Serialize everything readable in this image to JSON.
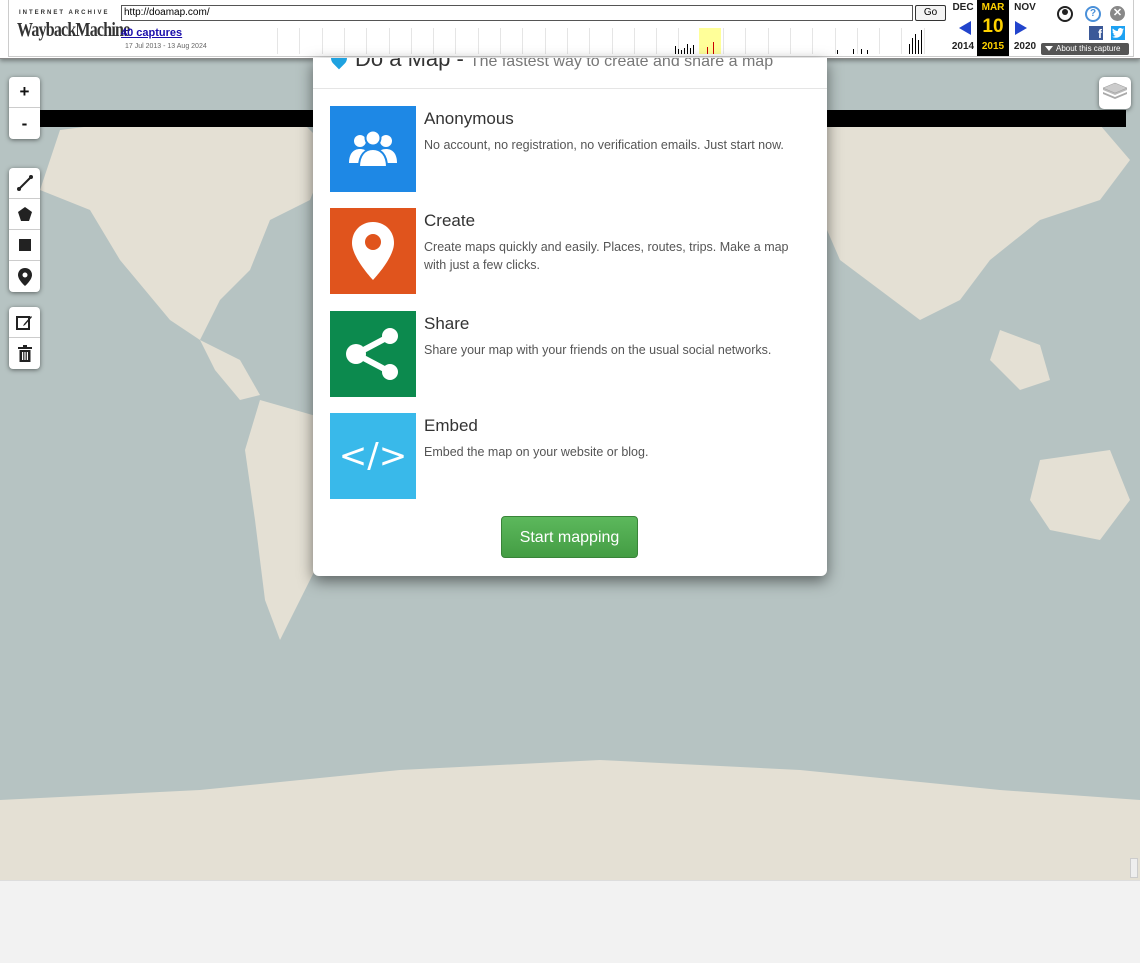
{
  "wayback": {
    "logo_top": "INTERNET ARCHIVE",
    "logo_wayback": "Wayback",
    "logo_machine": "Machine",
    "url": "http://doamap.com/",
    "go_label": "Go",
    "captures": "40 captures",
    "range": "17 Jul 2013 - 13 Aug 2024",
    "prev_month": "DEC",
    "prev_year": "2014",
    "cur_month": "MAR",
    "cur_day": "10",
    "cur_year": "2015",
    "next_month": "NOV",
    "next_year": "2020",
    "help_glyph": "?",
    "close_glyph": "✕",
    "fb_glyph": "f",
    "about": "About this capture"
  },
  "map_controls": {
    "zoom_in": "+",
    "zoom_out": "-"
  },
  "modal": {
    "title": "Do a Map -",
    "subtitle": "The fastest way to create and share a map",
    "features": [
      {
        "title": "Anonymous",
        "desc": "No account, no registration, no verification emails. Just start now.",
        "color": "#1e88e5",
        "icon": "users-icon"
      },
      {
        "title": "Create",
        "desc": "Create maps quickly and easily. Places, routes, trips. Make a map with just a few clicks.",
        "color": "#e0541d",
        "icon": "map-pin-icon"
      },
      {
        "title": "Share",
        "desc": "Share your map with your friends on the usual social networks.",
        "color": "#0c8a4e",
        "icon": "share-icon"
      },
      {
        "title": "Embed",
        "desc": "Embed the map on your website or blog.",
        "color": "#39b9ea",
        "icon": "code-icon",
        "glyph": "</>"
      }
    ],
    "start_label": "Start mapping"
  },
  "colors": {
    "ocean": "#b6c3c2",
    "land": "#e4e0d4",
    "start_button": "#5cb85c"
  }
}
